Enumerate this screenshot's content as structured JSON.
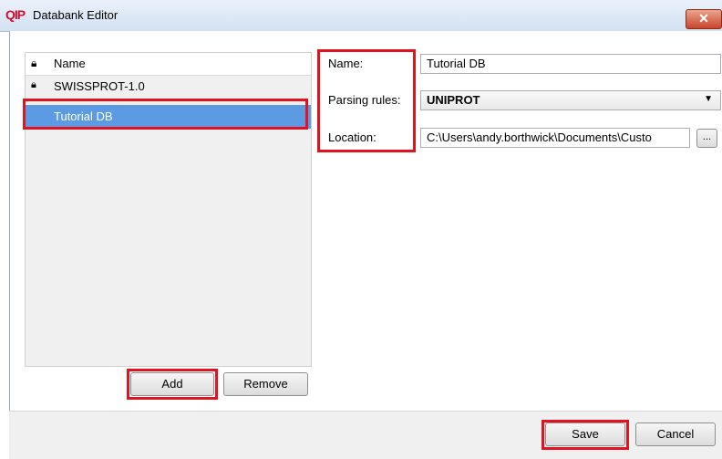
{
  "window": {
    "logo_text": "QIP",
    "title": "Databank Editor",
    "close_glyph": "✕"
  },
  "databank_list": {
    "header": {
      "lock_icon": "lock-icon",
      "name_label": "Name"
    },
    "items": [
      {
        "label": "SWISSPROT-1.0",
        "locked": true,
        "selected": false
      },
      {
        "label": "Tutorial DB",
        "locked": false,
        "selected": true
      }
    ]
  },
  "list_buttons": {
    "add_label": "Add",
    "remove_label": "Remove"
  },
  "details": {
    "name": {
      "label": "Name:",
      "value": "Tutorial DB"
    },
    "parsing_rules": {
      "label": "Parsing rules:",
      "value": "UNIPROT"
    },
    "location": {
      "label": "Location:",
      "value": "C:\\Users\\andy.borthwick\\Documents\\Custo",
      "browse_label": "..."
    }
  },
  "footer": {
    "save_label": "Save",
    "cancel_label": "Cancel"
  },
  "colors": {
    "highlight": "#e0131f",
    "selection": "#5c9ae3",
    "logo": "#c8102e"
  }
}
